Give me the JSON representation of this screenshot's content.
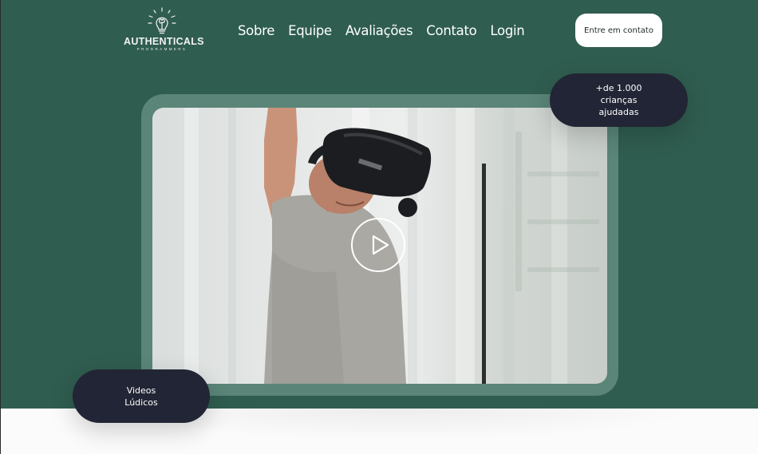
{
  "brand": {
    "name": "AUTHENTICALS",
    "tagline": "PROGRAMMERS",
    "icon": "lightbulb-brain-icon"
  },
  "nav": {
    "items": [
      "Sobre",
      "Equipe",
      "Avaliações",
      "Contato",
      "Login"
    ]
  },
  "header": {
    "cta_label": "Entre em contato"
  },
  "hero": {
    "stat_badge": "+de 1.000 crianças ajudadas",
    "video_badge": "Videos Lúdicos",
    "video": {
      "description_icon": "play-icon"
    }
  },
  "colors": {
    "hero_bg": "#2f5d4f",
    "frame": "#5a8578",
    "badge_bg": "#222535",
    "cta_bg": "#ffffff"
  }
}
